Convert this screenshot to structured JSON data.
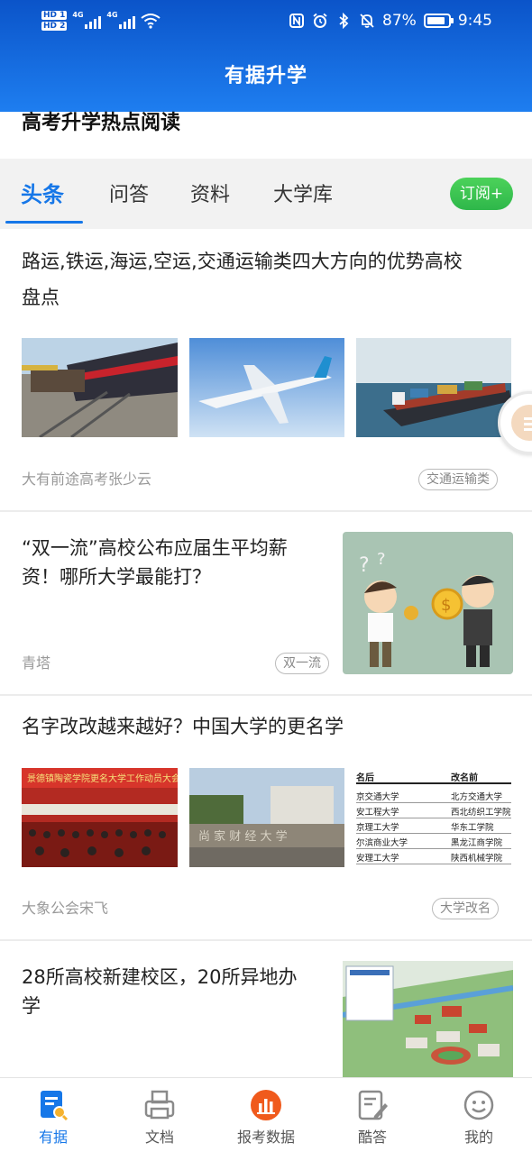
{
  "status_bar": {
    "hd1": "HD 1",
    "hd2": "HD 2",
    "net1": "4G",
    "net2": "4G",
    "battery_pct": "87%",
    "battery_level": 0.87,
    "time": "9:45"
  },
  "header": {
    "title": "有据升学"
  },
  "section": {
    "title": "高考升学热点阅读"
  },
  "tabs": [
    {
      "label": "头条",
      "active": true
    },
    {
      "label": "问答"
    },
    {
      "label": "资料"
    },
    {
      "label": "大学库"
    }
  ],
  "subscribe_label": "订阅+",
  "articles": [
    {
      "title_line1": "路运,铁运,海运,空运,交通运输类四大方向的优势高校",
      "title_line2": "盘点",
      "source": "大有前途高考张少云",
      "tag": "交通运输类",
      "images": [
        "freight-train-photo",
        "airplane-photo",
        "container-ship-photo"
      ]
    },
    {
      "title_line1": "“双一流”高校公布应届生平均薪",
      "title_line2": "资！哪所大学最能打？",
      "source": "青塔",
      "tag": "双一流",
      "images": [
        "salary-cartoon-illustration"
      ]
    },
    {
      "title_line1": "名字改改越来越好？中国大学的更名学",
      "source": "大象公会宋飞",
      "tag": "大学改名",
      "images": [
        "meeting-hall-photo",
        "university-gate-photo",
        "rename-table-image"
      ],
      "rename_table": {
        "header_new": "名后",
        "header_old": "改名前",
        "rows": [
          [
            "京交通大学",
            "北方交通大学"
          ],
          [
            "安工程大学",
            "西北纺织工学院"
          ],
          [
            "京理工大学",
            "华东工学院"
          ],
          [
            "尔滨商业大学",
            "黑龙江商学院"
          ],
          [
            "安理工大学",
            "陕西机械学院"
          ]
        ]
      }
    },
    {
      "title_line1": "28所高校新建校区，20所异地办",
      "title_line2": "学",
      "images": [
        "campus-map-image"
      ]
    }
  ],
  "bottom_nav": [
    {
      "label": "有据",
      "icon": "document-search-icon",
      "active": true
    },
    {
      "label": "文档",
      "icon": "printer-doc-icon"
    },
    {
      "label": "报考数据",
      "icon": "bar-chart-circle-icon"
    },
    {
      "label": "酷答",
      "icon": "edit-doc-icon"
    },
    {
      "label": "我的",
      "icon": "smiley-user-icon"
    }
  ],
  "colors": {
    "header_top": "#0b54c9",
    "header_bottom": "#1e7ef0",
    "accent": "#1677e8",
    "subscribe_green": "#3cc552",
    "nav_orange": "#f05a1c"
  }
}
